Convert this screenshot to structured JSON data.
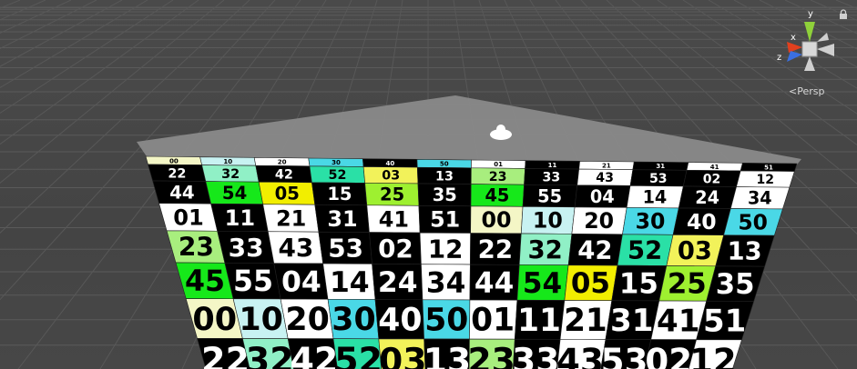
{
  "scene": {
    "tile_colors": {
      "black": "#000000",
      "white": "#ffffff",
      "pale_yellow": "#f4f6c6",
      "yellow": "#f2f25a",
      "bright_yellow": "#f2ee00",
      "light_cyan": "#c8f2f2",
      "cyan": "#4ad8e6",
      "mint": "#90f0c6",
      "teal_green": "#2ae0a6",
      "light_green": "#a8ee7e",
      "lime": "#9ef030",
      "bright_green": "#16e81a",
      "green": "#3ad83a",
      "pale_green": "#b8ee9e"
    },
    "grid_rows": [
      [
        {
          "label": "00",
          "fill": "pale_yellow"
        },
        {
          "label": "10",
          "fill": "light_cyan"
        },
        {
          "label": "20",
          "fill": "white"
        },
        {
          "label": "30",
          "fill": "cyan"
        },
        {
          "label": "40",
          "fill": "black"
        },
        {
          "label": "50",
          "fill": "cyan"
        },
        {
          "label": "01",
          "fill": "white"
        },
        {
          "label": "11",
          "fill": "black"
        },
        {
          "label": "21",
          "fill": "white"
        },
        {
          "label": "31",
          "fill": "black"
        },
        {
          "label": "41",
          "fill": "white"
        },
        {
          "label": "51",
          "fill": "black"
        }
      ],
      [
        {
          "label": "02",
          "fill": "black"
        },
        {
          "label": "12",
          "fill": "white"
        },
        {
          "label": "22",
          "fill": "black"
        },
        {
          "label": "32",
          "fill": "mint"
        },
        {
          "label": "42",
          "fill": "black"
        },
        {
          "label": "52",
          "fill": "teal_green"
        },
        {
          "label": "03",
          "fill": "yellow"
        },
        {
          "label": "13",
          "fill": "black"
        },
        {
          "label": "23",
          "fill": "light_green"
        },
        {
          "label": "33",
          "fill": "black"
        },
        {
          "label": "43",
          "fill": "white"
        },
        {
          "label": "53",
          "fill": "black"
        }
      ],
      [
        {
          "label": "04",
          "fill": "black"
        },
        {
          "label": "14",
          "fill": "white"
        },
        {
          "label": "24",
          "fill": "black"
        },
        {
          "label": "34",
          "fill": "white"
        },
        {
          "label": "44",
          "fill": "black"
        },
        {
          "label": "54",
          "fill": "bright_green"
        },
        {
          "label": "05",
          "fill": "bright_yellow"
        },
        {
          "label": "15",
          "fill": "black"
        },
        {
          "label": "25",
          "fill": "lime"
        },
        {
          "label": "35",
          "fill": "black"
        },
        {
          "label": "45",
          "fill": "bright_green"
        },
        {
          "label": "55",
          "fill": "black"
        }
      ]
    ],
    "visible_numbers": [
      "00",
      "01",
      "02",
      "03",
      "04",
      "05",
      "10",
      "11",
      "12",
      "13",
      "14",
      "15",
      "20",
      "21",
      "22",
      "23",
      "24",
      "25",
      "30",
      "31",
      "32",
      "33",
      "34",
      "35",
      "40",
      "41",
      "42",
      "43",
      "44",
      "45",
      "50",
      "51",
      "52",
      "53",
      "54",
      "55"
    ]
  },
  "gizmo": {
    "axis_y": "y",
    "axis_x": "x",
    "axis_z": "z",
    "color_y": "#8fd13a",
    "color_x": "#e0401e",
    "color_z": "#3a6fe0"
  },
  "projection": {
    "label": "Persp",
    "icon": "chevron-left-icon"
  },
  "icons": [
    "lock-icon",
    "directional-light-icon"
  ]
}
